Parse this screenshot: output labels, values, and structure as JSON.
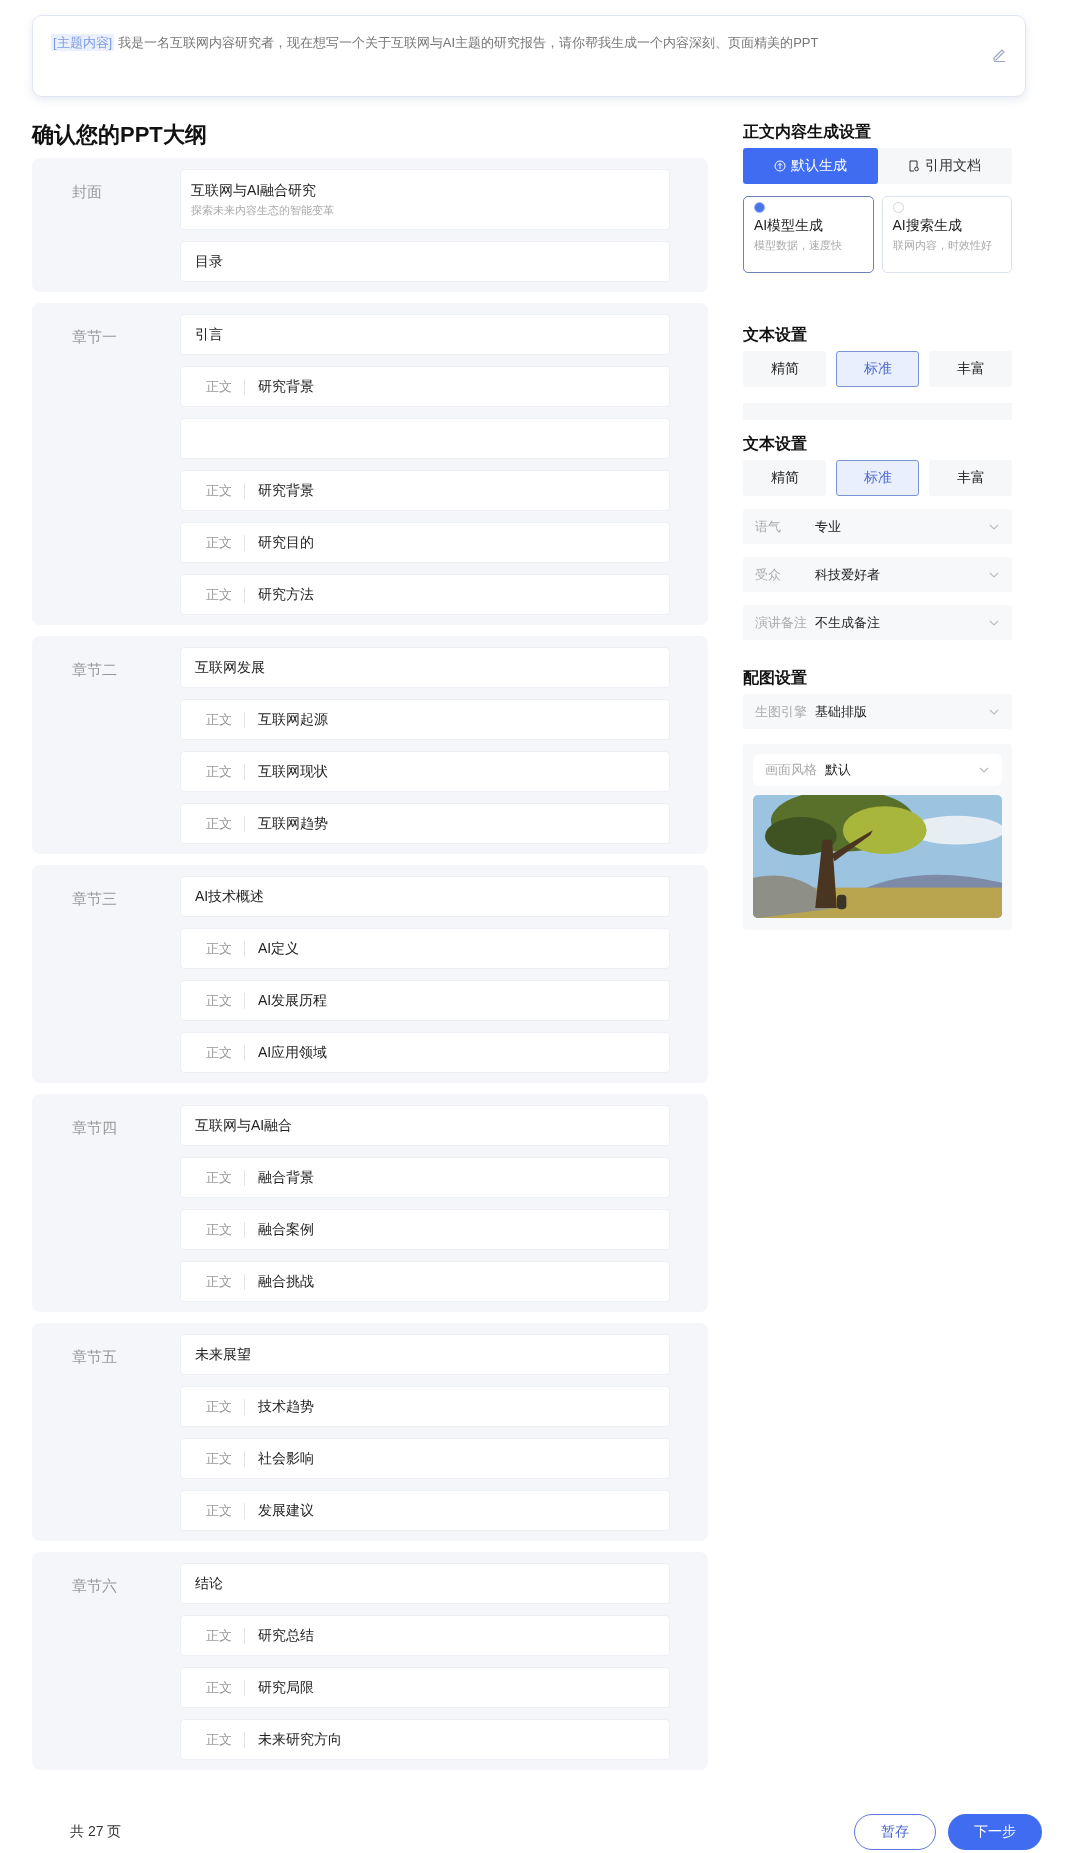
{
  "prompt": {
    "tag": "[主题内容]",
    "text": "我是一名互联网内容研究者，现在想写一个关于互联网与AI主题的研究报告，请你帮我生成一个内容深刻、页面精美的PPT"
  },
  "outline": {
    "title": "确认您的PPT大纲",
    "groups": [
      {
        "label": "封面",
        "items": [
          {
            "kind": "cover",
            "text": "互联网与AI融合研究",
            "subtitle": "探索未来内容生态的智能变革"
          },
          {
            "kind": "title",
            "text": "目录"
          }
        ]
      },
      {
        "label": "章节一",
        "items": [
          {
            "kind": "title",
            "text": "引言"
          },
          {
            "kind": "body",
            "tag": "正文",
            "text": "研究背景"
          },
          {
            "kind": "blank"
          },
          {
            "kind": "body",
            "tag": "正文",
            "text": "研究背景"
          },
          {
            "kind": "body",
            "tag": "正文",
            "text": "研究目的"
          },
          {
            "kind": "body",
            "tag": "正文",
            "text": "研究方法"
          }
        ]
      },
      {
        "label": "章节二",
        "items": [
          {
            "kind": "title",
            "text": "互联网发展"
          },
          {
            "kind": "body",
            "tag": "正文",
            "text": "互联网起源"
          },
          {
            "kind": "body",
            "tag": "正文",
            "text": "互联网现状"
          },
          {
            "kind": "body",
            "tag": "正文",
            "text": "互联网趋势"
          }
        ]
      },
      {
        "label": "章节三",
        "items": [
          {
            "kind": "title",
            "text": "AI技术概述"
          },
          {
            "kind": "body",
            "tag": "正文",
            "text": "AI定义"
          },
          {
            "kind": "body",
            "tag": "正文",
            "text": "AI发展历程"
          },
          {
            "kind": "body",
            "tag": "正文",
            "text": "AI应用领域"
          }
        ]
      },
      {
        "label": "章节四",
        "items": [
          {
            "kind": "title",
            "text": "互联网与AI融合"
          },
          {
            "kind": "body",
            "tag": "正文",
            "text": "融合背景"
          },
          {
            "kind": "body",
            "tag": "正文",
            "text": "融合案例"
          },
          {
            "kind": "body",
            "tag": "正文",
            "text": "融合挑战"
          }
        ]
      },
      {
        "label": "章节五",
        "items": [
          {
            "kind": "title",
            "text": "未来展望"
          },
          {
            "kind": "body",
            "tag": "正文",
            "text": "技术趋势"
          },
          {
            "kind": "body",
            "tag": "正文",
            "text": "社会影响"
          },
          {
            "kind": "body",
            "tag": "正文",
            "text": "发展建议"
          }
        ]
      },
      {
        "label": "章节六",
        "items": [
          {
            "kind": "title",
            "text": "结论"
          },
          {
            "kind": "body",
            "tag": "正文",
            "text": "研究总结"
          },
          {
            "kind": "body",
            "tag": "正文",
            "text": "研究局限"
          },
          {
            "kind": "body",
            "tag": "正文",
            "text": "未来研究方向"
          }
        ]
      }
    ]
  },
  "settings": [
    {
      "kind": "heading",
      "text": "正文内容生成设置"
    },
    {
      "kind": "tabs",
      "tabs": [
        {
          "label": "默认生成",
          "selected": true
        },
        {
          "label": "引用文档",
          "selected": false
        }
      ]
    },
    {
      "kind": "modes",
      "options": [
        {
          "title": "AI模型生成",
          "desc": "模型数据，速度快",
          "selected": true
        },
        {
          "title": "AI搜索生成",
          "desc": "联网内容，时效性好",
          "selected": false
        }
      ]
    },
    {
      "kind": "heading",
      "text": "文本设置"
    },
    {
      "kind": "segments",
      "options": [
        {
          "label": "精简",
          "selected": false
        },
        {
          "label": "标准",
          "selected": true
        },
        {
          "label": "丰富",
          "selected": false
        }
      ]
    },
    {
      "kind": "clipped"
    },
    {
      "kind": "heading",
      "text": "文本设置"
    },
    {
      "kind": "segments",
      "options": [
        {
          "label": "精简",
          "selected": false
        },
        {
          "label": "标准",
          "selected": true
        },
        {
          "label": "丰富",
          "selected": false
        }
      ]
    },
    {
      "kind": "select",
      "label": "语气",
      "value": "专业"
    },
    {
      "kind": "select",
      "label": "受众",
      "value": "科技爱好者"
    },
    {
      "kind": "select",
      "label": "演讲备注",
      "value": "不生成备注"
    },
    {
      "kind": "heading",
      "text": "配图设置"
    },
    {
      "kind": "select",
      "label": "生图引擎",
      "value": "基础排版"
    },
    {
      "kind": "style",
      "label": "画面风格",
      "value": "默认"
    }
  ],
  "footer": {
    "pages": "共 27 页",
    "buttons": [
      {
        "label": "暂存",
        "kind": "outline"
      },
      {
        "label": "下一步",
        "kind": "primary"
      }
    ]
  }
}
